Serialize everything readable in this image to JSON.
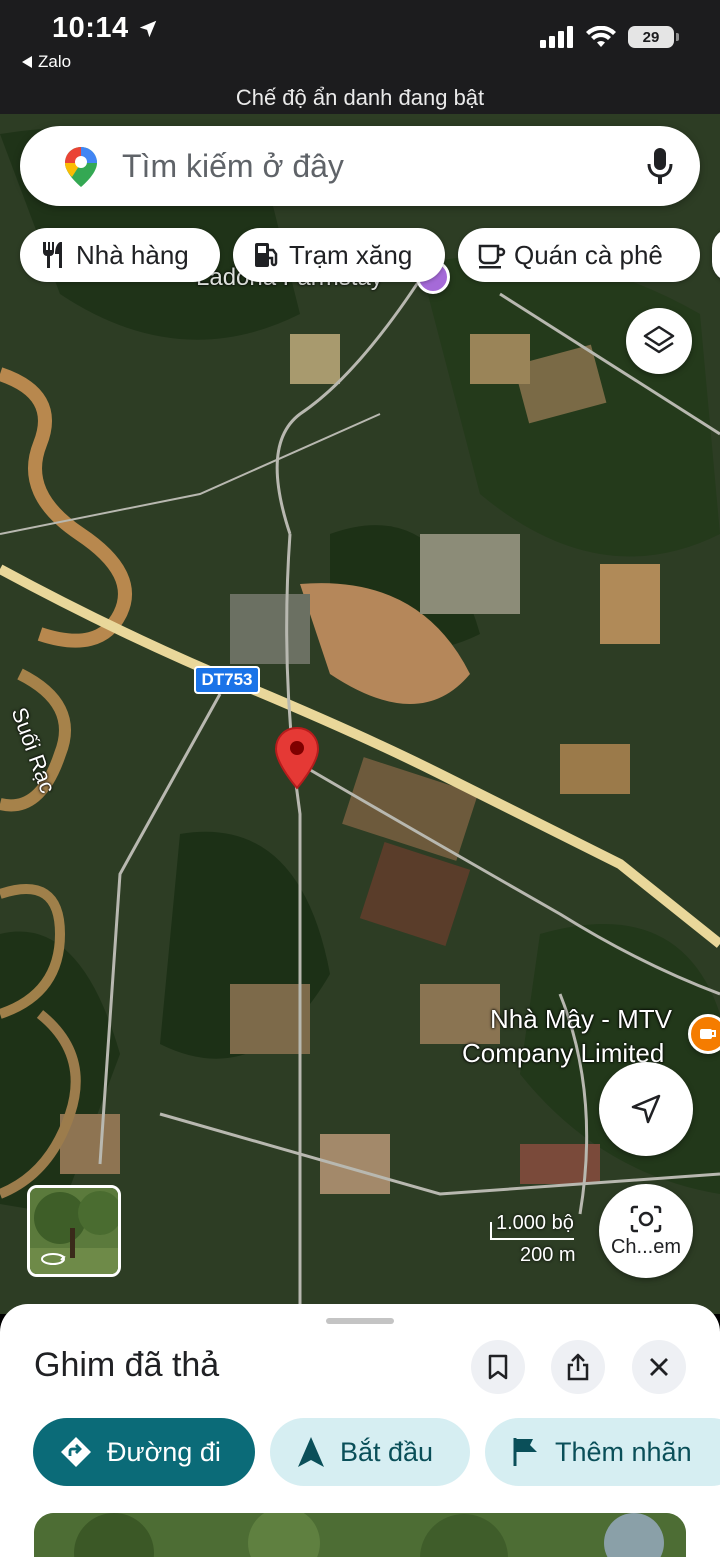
{
  "status_bar": {
    "time": "10:14",
    "back_app": "Zalo",
    "battery": "29"
  },
  "incognito_banner": "Chế độ ẩn danh đang bật",
  "search": {
    "placeholder": "Tìm kiếm ở đây"
  },
  "chips": [
    {
      "label": "Nhà hàng",
      "icon": "restaurant-icon"
    },
    {
      "label": "Trạm xăng",
      "icon": "gas-station-icon"
    },
    {
      "label": "Quán cà phê",
      "icon": "coffee-icon"
    }
  ],
  "map": {
    "place_label_top": "Ladona Farmstay",
    "stream_label": "Suối Rạc",
    "road_shield": "DT753",
    "poi_label_line1": "Nhà Mây - MTV",
    "poi_label_line2": "Company Limited",
    "scale_imperial": "1.000 bộ",
    "scale_metric": "200 m",
    "lens_label": "Ch...em"
  },
  "sheet": {
    "title": "Ghim đã thả",
    "actions": [
      {
        "label": "Đường đi",
        "icon": "directions-icon"
      },
      {
        "label": "Bắt đầu",
        "icon": "navigation-arrow-icon"
      },
      {
        "label": "Thêm nhãn",
        "icon": "flag-icon"
      }
    ]
  },
  "colors": {
    "primary_action": "#0b6b78",
    "secondary_action": "#d6eef2",
    "pin": "#e53935",
    "road_shield": "#1a73e8"
  }
}
